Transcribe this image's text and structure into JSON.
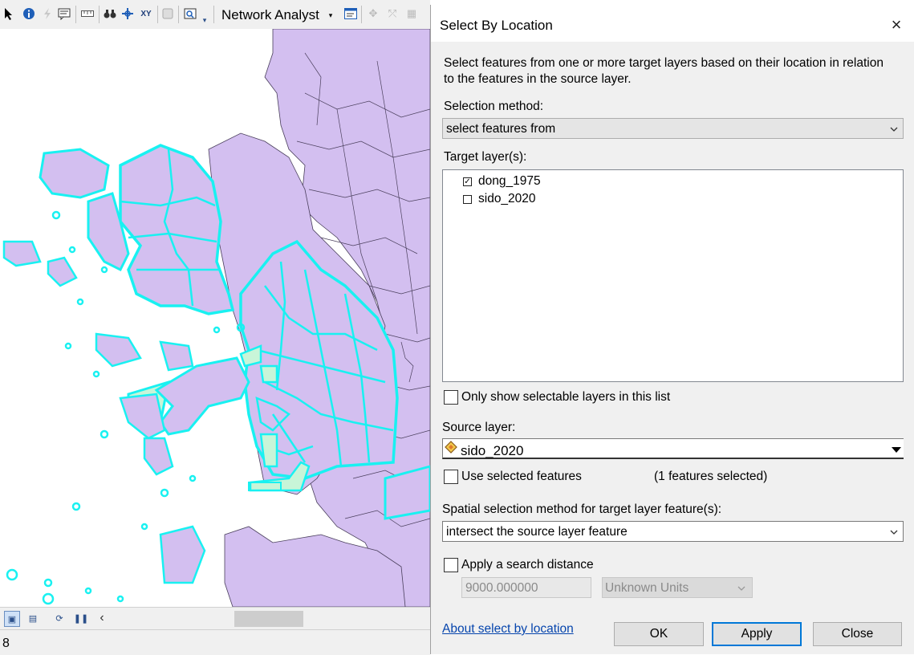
{
  "toolbar": {
    "network_analyst_label": "Network Analyst",
    "icons": [
      "select-arrow-icon",
      "identify-icon",
      "hyperlink-icon",
      "html-popup-icon",
      "measure-icon",
      "find-icon",
      "go-to-xy-icon",
      "xy-icon",
      "view-results-icon",
      "create-viewer-icon"
    ]
  },
  "map": {
    "colors": {
      "land": "#d3bff0",
      "border": "#4a3f5c",
      "selected_outline": "#19f1f1",
      "source_fill": "#c8f5d8",
      "water": "#ffffff"
    }
  },
  "statusbar": {
    "status_text": "8"
  },
  "dialog": {
    "title": "Select By Location",
    "description_line1": "Select features from one or more target layers based on their location in relation",
    "description_line2": "to the features in the source layer.",
    "selection_method_label": "Selection method:",
    "selection_method_value": "select features from",
    "target_layers_label": "Target layer(s):",
    "target_layers": [
      {
        "name": "dong_1975",
        "checked": true
      },
      {
        "name": "sido_2020",
        "checked": false
      }
    ],
    "only_selectable_label": "Only show selectable layers in this list",
    "source_layer_label": "Source layer:",
    "source_layer_value": "sido_2020",
    "use_selected_label": "Use selected features",
    "features_selected_text": "(1 features selected)",
    "spatial_method_label": "Spatial selection method for target layer feature(s):",
    "spatial_method_value": "intersect the source layer feature",
    "apply_search_distance_label": "Apply a search distance",
    "search_distance_value": "9000.000000",
    "units_value": "Unknown Units",
    "about_link": "About select by location",
    "ok_label": "OK",
    "apply_label": "Apply",
    "close_label": "Close",
    "close_icon": "×"
  }
}
